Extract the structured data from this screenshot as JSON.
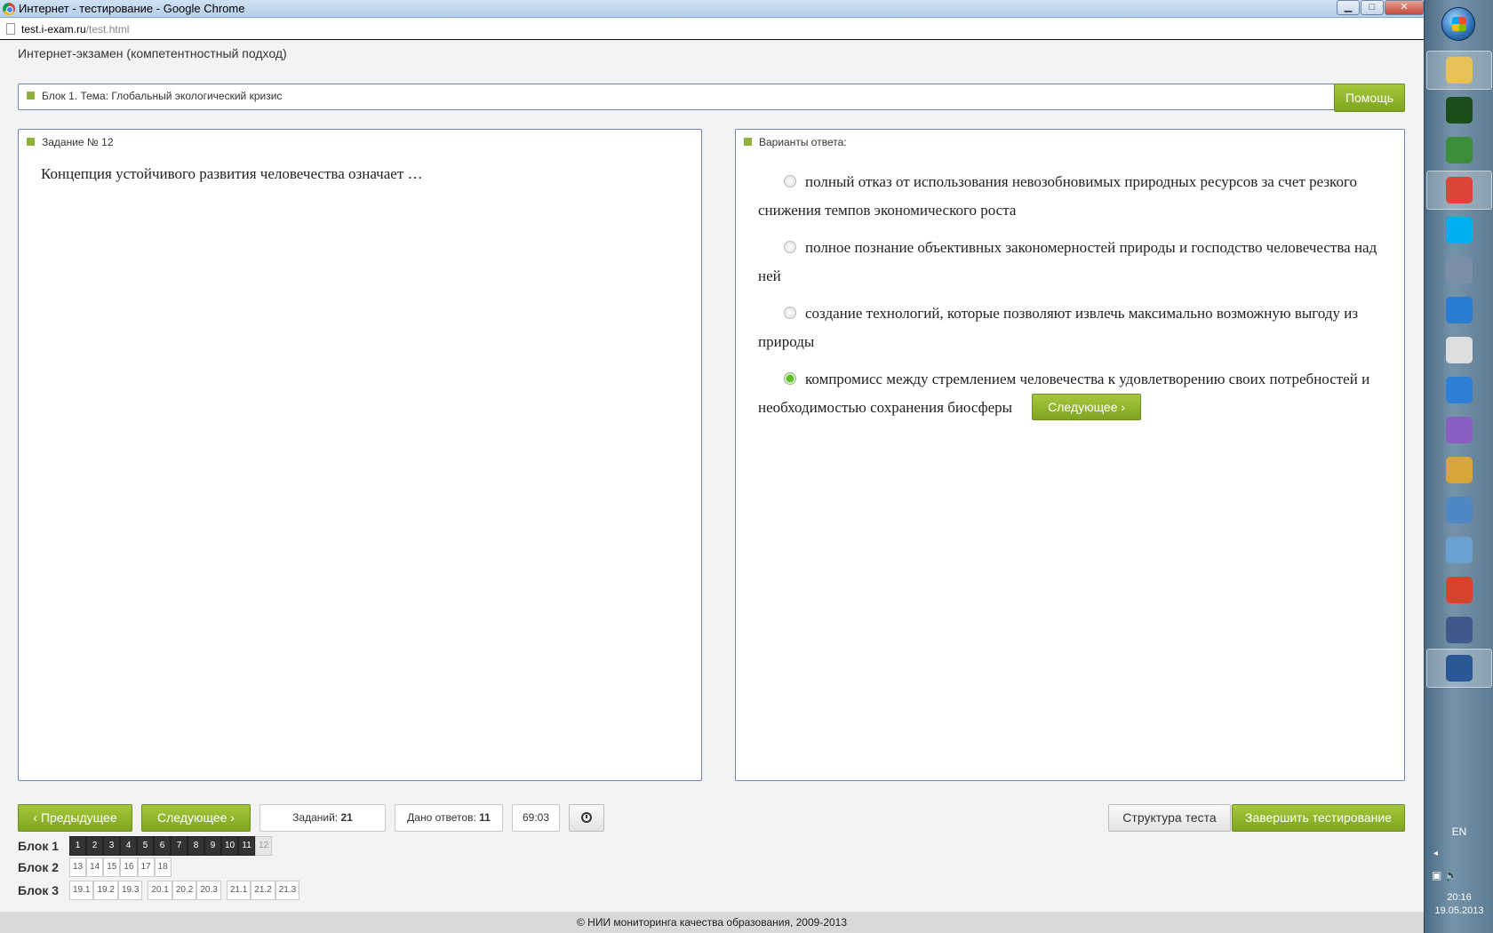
{
  "window": {
    "title": "Интернет - тестирование - Google Chrome",
    "controls": {
      "minimize": "▁",
      "maximize": "□",
      "close": "✕"
    }
  },
  "address": {
    "host": "test.i-exam.ru",
    "path": "/test.html"
  },
  "exam": {
    "header": "Интернет-экзамен (компетентностный подход)",
    "block_title": "Блок 1. Тема: Глобальный экологический кризис",
    "help_label": "Помощь",
    "task_label": "Задание № 12",
    "question": "Концепция устойчивого развития человечества означает …",
    "answers_label": "Варианты ответа:",
    "answers": [
      {
        "text": "полный отказ от использования невозобновимых природных ресурсов за счет резкого снижения темпов экономического роста",
        "selected": false
      },
      {
        "text": "полное познание объективных закономерностей природы и господство человечества над ней",
        "selected": false
      },
      {
        "text": "создание технологий, которые позволяют извлечь максимально возможную выгоду из природы",
        "selected": false
      },
      {
        "text": "компромисс между стремлением человечества к удовлетворению своих потребностей и необходимостью сохранения биосферы",
        "selected": true
      }
    ],
    "next_inline_label": "Следующее"
  },
  "controls": {
    "prev_label": "Предыдущее",
    "next_label": "Следующее",
    "tasks_label": "Заданий:",
    "tasks_value": "21",
    "answered_label": "Дано ответов:",
    "answered_value": "11",
    "timer": "69:03",
    "structure_label": "Структура теста",
    "finish_label": "Завершить тестирование"
  },
  "blocks": [
    {
      "label": "Блок 1",
      "groups": [
        [
          "1",
          "2",
          "3",
          "4",
          "5",
          "6",
          "7",
          "8",
          "9",
          "10",
          "11",
          "12"
        ]
      ],
      "done_count": 11,
      "current": "12"
    },
    {
      "label": "Блок 2",
      "groups": [
        [
          "13",
          "14",
          "15",
          "16",
          "17",
          "18"
        ]
      ],
      "done_count": 0,
      "current": null
    },
    {
      "label": "Блок 3",
      "groups": [
        [
          "19.1",
          "19.2",
          "19.3"
        ],
        [
          "20.1",
          "20.2",
          "20.3"
        ],
        [
          "21.1",
          "21.2",
          "21.3"
        ]
      ],
      "done_count": 0,
      "current": null
    }
  ],
  "footer": "© НИИ мониторинга качества образования, 2009-2013",
  "taskbar": {
    "items": [
      {
        "name": "explorer-icon",
        "color": "#e8c259",
        "active": true
      },
      {
        "name": "matrix-app-icon",
        "color": "#1a4d1a",
        "active": false
      },
      {
        "name": "network-globe-icon",
        "color": "#3b8f3b",
        "active": false
      },
      {
        "name": "chrome-icon",
        "color": "#db4437",
        "active": true
      },
      {
        "name": "skype-icon",
        "color": "#00aff0",
        "active": false
      },
      {
        "name": "satellite-app-icon",
        "color": "#7b8da8",
        "active": false
      },
      {
        "name": "lightning-app-icon",
        "color": "#2a7bd4",
        "active": false
      },
      {
        "name": "fox-app-icon",
        "color": "#dddddd",
        "active": false
      },
      {
        "name": "daemon-tools-icon",
        "color": "#2f7fd8",
        "active": false
      },
      {
        "name": "visual-studio-icon",
        "color": "#8a5fc2",
        "active": false
      },
      {
        "name": "tools-shield-icon",
        "color": "#d9a43a",
        "active": false
      },
      {
        "name": "monitor-shield-icon",
        "color": "#4f86c4",
        "active": false
      },
      {
        "name": "wrench-shield-icon",
        "color": "#6aa0d0",
        "active": false
      },
      {
        "name": "ccleaner-icon",
        "color": "#d8432e",
        "active": false
      },
      {
        "name": "lock-app-icon",
        "color": "#3d5a8a",
        "active": false
      },
      {
        "name": "word-icon",
        "color": "#2b5797",
        "active": true
      }
    ],
    "lang": "EN",
    "time": "20:16",
    "date": "19.05.2013"
  }
}
